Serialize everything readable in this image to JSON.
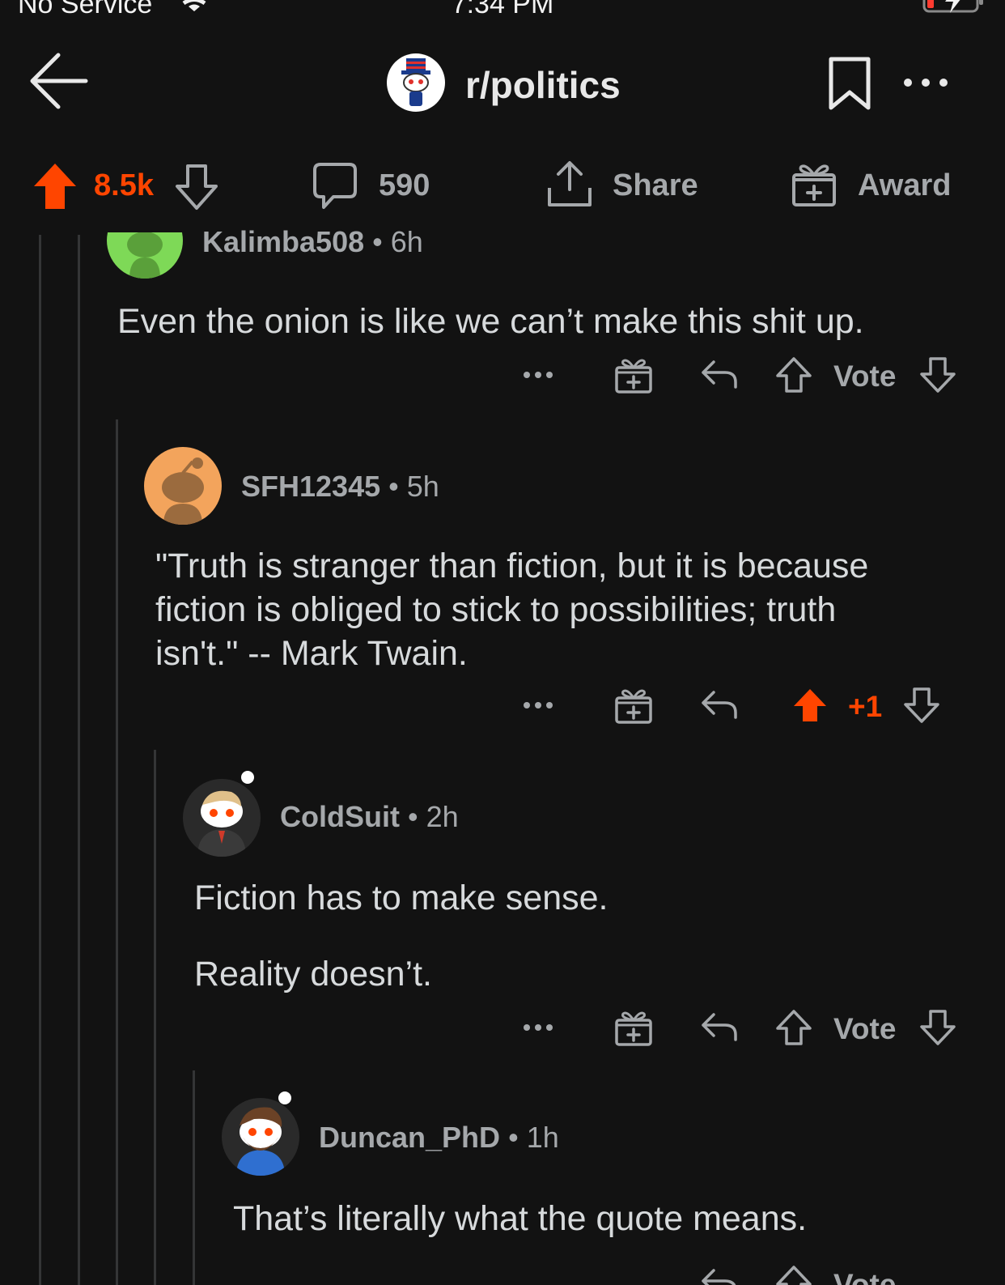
{
  "status_bar": {
    "carrier": "No Service",
    "time": "7:34 PM"
  },
  "header": {
    "subreddit": "r/politics"
  },
  "action_bar": {
    "score": "8.5k",
    "comments": "590",
    "share": "Share",
    "award": "Award"
  },
  "comments": [
    {
      "author": "Kalimba508",
      "age": "6h",
      "body": [
        "Even the onion is like we can’t make this shit up."
      ],
      "vote": "Vote",
      "avatar_color": "#7ed957"
    },
    {
      "author": "SFH12345",
      "age": "5h",
      "body": [
        "\"Truth is stranger than fiction, but it is because",
        "fiction is obliged to stick to possibilities; truth",
        "isn't.\" -- Mark Twain."
      ],
      "vote": "+1",
      "avatar_color": "#f3a45c"
    },
    {
      "author": "ColdSuit",
      "age": "2h",
      "body": [
        "Fiction has to make sense.",
        "Reality doesn’t."
      ],
      "vote": "Vote"
    },
    {
      "author": "Duncan_PhD",
      "age": "1h",
      "body": [
        "That’s literally what the quote means."
      ],
      "vote": "Vote"
    }
  ],
  "separator": "•",
  "colors": {
    "background": "#121212",
    "upvote": "#ff4500",
    "meta_text": "#a5a8ab",
    "body_text": "#d7dadc"
  }
}
